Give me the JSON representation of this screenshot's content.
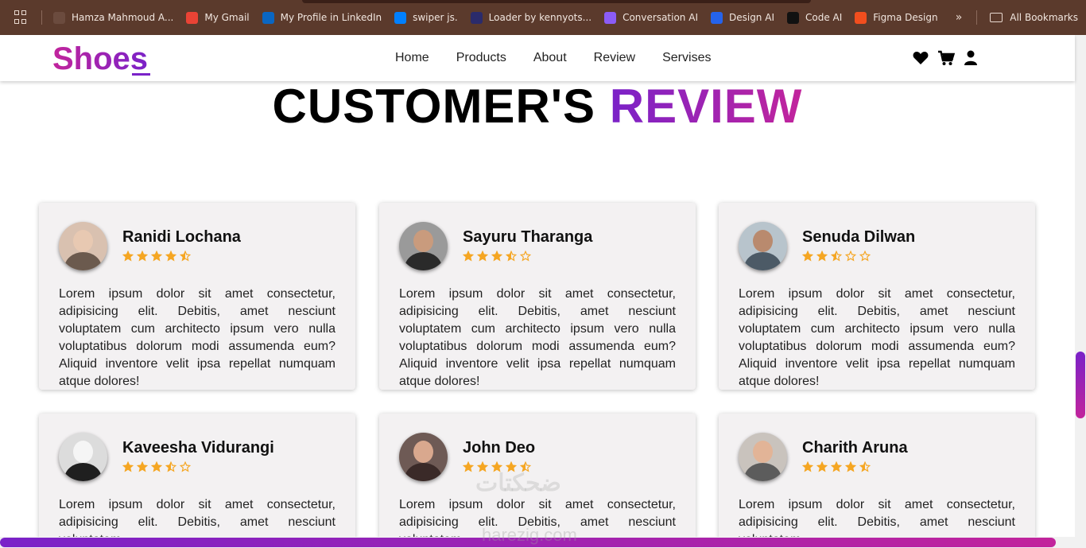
{
  "bookmarks": {
    "items": [
      {
        "label": "Hamza Mahmoud A...",
        "color": "#6b4b3e"
      },
      {
        "label": "My Gmail",
        "color": "#ea4335"
      },
      {
        "label": "My Profile in LinkedIn",
        "color": "#0a66c2"
      },
      {
        "label": "swiper js.",
        "color": "#0080ff"
      },
      {
        "label": "Loader by kennyots...",
        "color": "#2b2b6b"
      },
      {
        "label": "Conversation AI",
        "color": "#8b5cf6"
      },
      {
        "label": "Design AI",
        "color": "#2563eb"
      },
      {
        "label": "Code AI",
        "color": "#111111"
      },
      {
        "label": "Figma Design",
        "color": "#f24e1e"
      }
    ],
    "all_label": "All Bookmarks"
  },
  "site": {
    "logo": "Shoes",
    "nav": [
      "Home",
      "Products",
      "About",
      "Review",
      "Servises"
    ],
    "icons": [
      "heart-icon",
      "cart-icon",
      "user-icon"
    ]
  },
  "heading": {
    "part1": "CUSTOMER'S",
    "part2": "REVIEW"
  },
  "reviews": [
    {
      "name": "Ranidi Lochana",
      "rating": 4.5,
      "text": "Lorem ipsum dolor sit amet consectetur, adipisicing elit. Debitis, amet nesciunt voluptatem cum architecto ipsum vero nulla voluptatibus dolorum modi assumenda eum? Aliquid inventore velit ipsa repellat numquam atque dolores!"
    },
    {
      "name": "Sayuru Tharanga",
      "rating": 3.5,
      "text": "Lorem ipsum dolor sit amet consectetur, adipisicing elit. Debitis, amet nesciunt voluptatem cum architecto ipsum vero nulla voluptatibus dolorum modi assumenda eum? Aliquid inventore velit ipsa repellat numquam atque dolores!"
    },
    {
      "name": "Senuda Dilwan",
      "rating": 2.5,
      "text": "Lorem ipsum dolor sit amet consectetur, adipisicing elit. Debitis, amet nesciunt voluptatem cum architecto ipsum vero nulla voluptatibus dolorum modi assumenda eum? Aliquid inventore velit ipsa repellat numquam atque dolores!"
    },
    {
      "name": "Kaveesha Vidurangi",
      "rating": 3.5,
      "text": "Lorem ipsum dolor sit amet consectetur, adipisicing elit. Debitis, amet nesciunt voluptatem"
    },
    {
      "name": "John Deo",
      "rating": 4.5,
      "text": "Lorem ipsum dolor sit amet consectetur, adipisicing elit. Debitis, amet nesciunt voluptatem"
    },
    {
      "name": "Charith Aruna",
      "rating": 4.5,
      "text": "Lorem ipsum dolor sit amet consectetur, adipisicing elit. Debitis, amet nesciunt voluptatem"
    }
  ],
  "colors": {
    "accent_purple": "#7a22c8",
    "accent_pink": "#c2249c",
    "star": "#f5a623",
    "bookmark_bar": "#5b3a2c"
  },
  "watermark": {
    "line1": "ضحكتات",
    "line2": "harezig.com"
  }
}
